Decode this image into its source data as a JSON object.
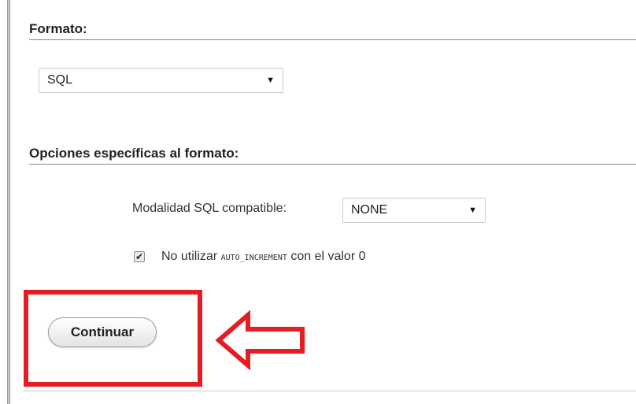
{
  "format_section": {
    "heading": "Formato:",
    "select_value": "SQL"
  },
  "options_section": {
    "heading": "Opciones específicas al formato:",
    "compat_label": "Modalidad SQL compatible:",
    "compat_value": "NONE",
    "checkbox": {
      "checked": true,
      "text_before": "No utilizar ",
      "code": "AUTO_INCREMENT",
      "text_after": " con el valor 0"
    }
  },
  "actions": {
    "continue_label": "Continuar"
  },
  "icons": {
    "dropdown": "chevron-down-icon",
    "checkmark": "checkmark-icon",
    "pointer": "left-arrow-icon"
  },
  "colors": {
    "highlight": "#e51c23"
  }
}
